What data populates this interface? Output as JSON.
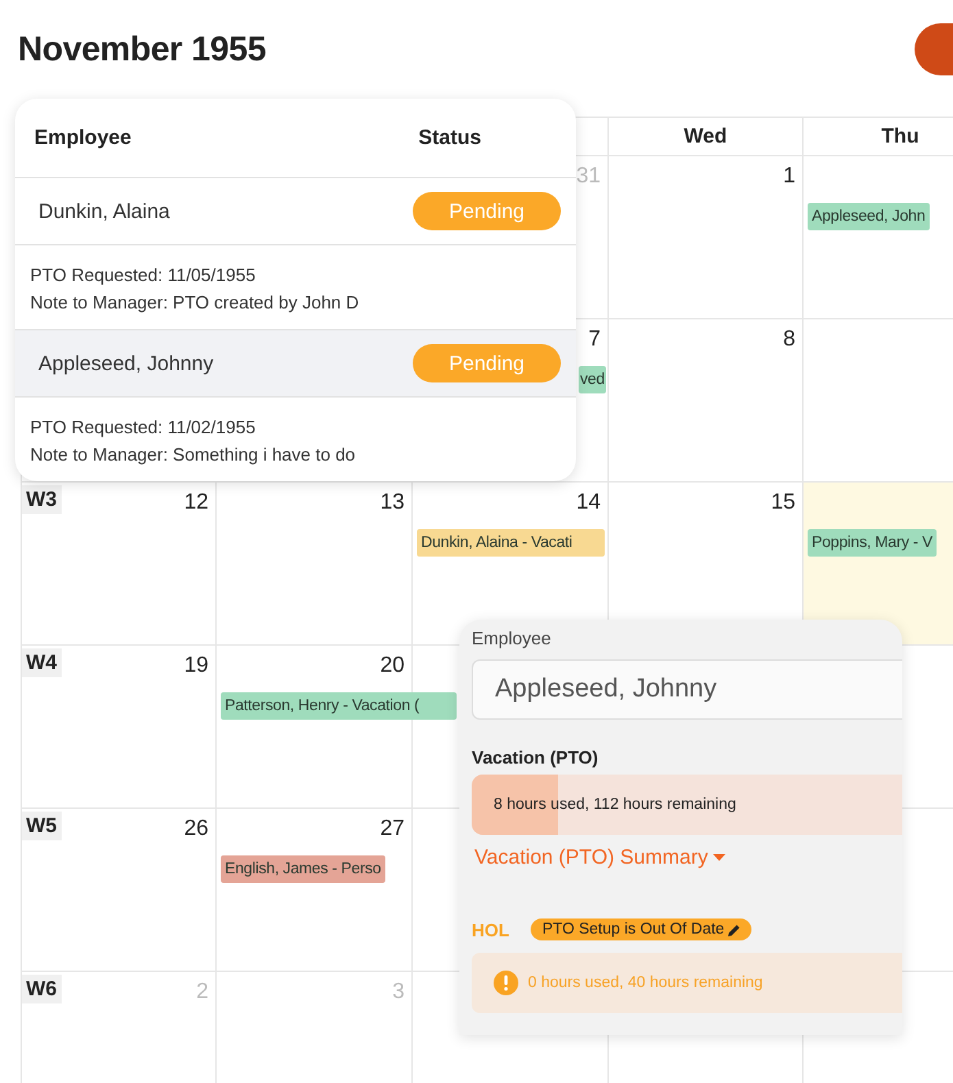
{
  "title": "November 1955",
  "weekday_headers": [
    "Wed",
    "Thu"
  ],
  "weeks": [
    {
      "cells": [
        {},
        {},
        {
          "day": "31",
          "muted": true,
          "today": false
        },
        {
          "day": "1",
          "muted": false,
          "today": false
        },
        {
          "today": false,
          "events": [
            {
              "text": "Appleseed, John",
              "color": "#9fdcbc"
            }
          ]
        }
      ]
    },
    {
      "cells": [
        {},
        {},
        {
          "day": "7",
          "muted": false,
          "today": false,
          "events": [
            {
              "text": "ved",
              "color": "#9fdcbc"
            }
          ]
        },
        {
          "day": "8",
          "muted": false,
          "today": false
        },
        {
          "today": false
        }
      ]
    },
    {
      "cells": [
        {
          "week": "W3",
          "day": "12",
          "muted": false,
          "today": false
        },
        {
          "day": "13",
          "muted": false,
          "today": false
        },
        {
          "day": "14",
          "muted": false,
          "today": false,
          "events": [
            {
              "text": "Dunkin, Alaina - Vacati",
              "color": "#f8d992"
            }
          ]
        },
        {
          "day": "15",
          "muted": false,
          "today": false
        },
        {
          "today": true,
          "events": [
            {
              "text": "Poppins, Mary - V",
              "color": "#9fdcbc"
            }
          ]
        }
      ]
    },
    {
      "cells": [
        {
          "week": "W4",
          "day": "19",
          "muted": false,
          "today": false
        },
        {
          "day": "20",
          "muted": false,
          "today": false,
          "events": [
            {
              "text": "Patterson, Henry - Vacation (",
              "color": "#9fdcbc"
            }
          ]
        },
        {},
        {},
        {}
      ]
    },
    {
      "cells": [
        {
          "week": "W5",
          "day": "26",
          "muted": false,
          "today": false
        },
        {
          "day": "27",
          "muted": false,
          "today": false,
          "events": [
            {
              "text": "English, James - Perso",
              "color": "#e4a496"
            }
          ]
        },
        {},
        {},
        {}
      ]
    },
    {
      "cells": [
        {
          "week": "W6",
          "day": "2",
          "muted": true,
          "today": false
        },
        {
          "day": "3",
          "muted": true,
          "today": false
        },
        {},
        {},
        {}
      ]
    }
  ],
  "requests_popover": {
    "columns": [
      "Employee",
      "Status"
    ],
    "rows": [
      {
        "employee": "Dunkin, Alaina",
        "status": "Pending",
        "selected": false,
        "details": [
          "PTO Requested: 11/05/1955",
          "Note to Manager: PTO created by John D"
        ]
      },
      {
        "employee": "Appleseed, Johnny",
        "status": "Pending",
        "selected": true,
        "details": [
          "PTO Requested: 11/02/1955",
          "Note to Manager: Something i have to do"
        ]
      }
    ]
  },
  "balance_popover": {
    "employee_label": "Employee",
    "employee_value": "Appleseed, Johnny",
    "balances": [
      {
        "kind": "bar",
        "name": "Vacation (PTO)",
        "level": 0.2,
        "reading": "8 hours used, 112 hours remaining",
        "summary_link": "Vacation (PTO) Summary"
      },
      {
        "kind": "warning",
        "name": "HOL",
        "badge": "PTO Setup is Out Of Date",
        "reading": "0 hours used, 40 hours remaining"
      }
    ]
  }
}
